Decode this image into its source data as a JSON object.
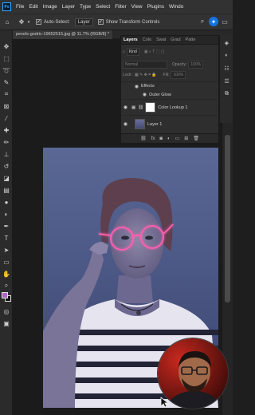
{
  "app": {
    "logo": "Ps"
  },
  "menu": [
    "File",
    "Edit",
    "Image",
    "Layer",
    "Type",
    "Select",
    "Filter",
    "View",
    "Plugins",
    "Windo"
  ],
  "options": {
    "auto_select_label": "Auto-Select:",
    "auto_select_checked": true,
    "target_value": "Layer",
    "show_transform_label": "Show Transform Controls",
    "show_transform_checked": true
  },
  "document": {
    "tab_title": "pexels-godric-19652516.jpg @ 11.7% (RGB/8) *"
  },
  "layers_panel": {
    "tabs": [
      "Layers",
      "Colo",
      "Swat",
      "Grad",
      "Patte"
    ],
    "active_tab": "Layers",
    "filter_value": "Kind",
    "blend_mode": "Normal",
    "opacity_label": "Opacity:",
    "opacity_value": "100%",
    "lock_label": "Lock:",
    "fill_label": "Fill:",
    "fill_value": "100%",
    "layers": [
      {
        "name": "Effects",
        "type": "effects-group"
      },
      {
        "name": "Outer Glow",
        "type": "effect"
      },
      {
        "name": "Color Lookup 1",
        "type": "adjustment"
      },
      {
        "name": "Layer 1",
        "type": "pixel"
      }
    ]
  },
  "colors": {
    "accent": "#1473e6",
    "foreground_swatch": "#b067c9",
    "background_swatch": "#111111",
    "glow": "#ff4fa3"
  },
  "icons": {
    "move": "move-icon",
    "search": "search-icon",
    "bulb": "bulb-icon",
    "layers": "layers-icon"
  }
}
